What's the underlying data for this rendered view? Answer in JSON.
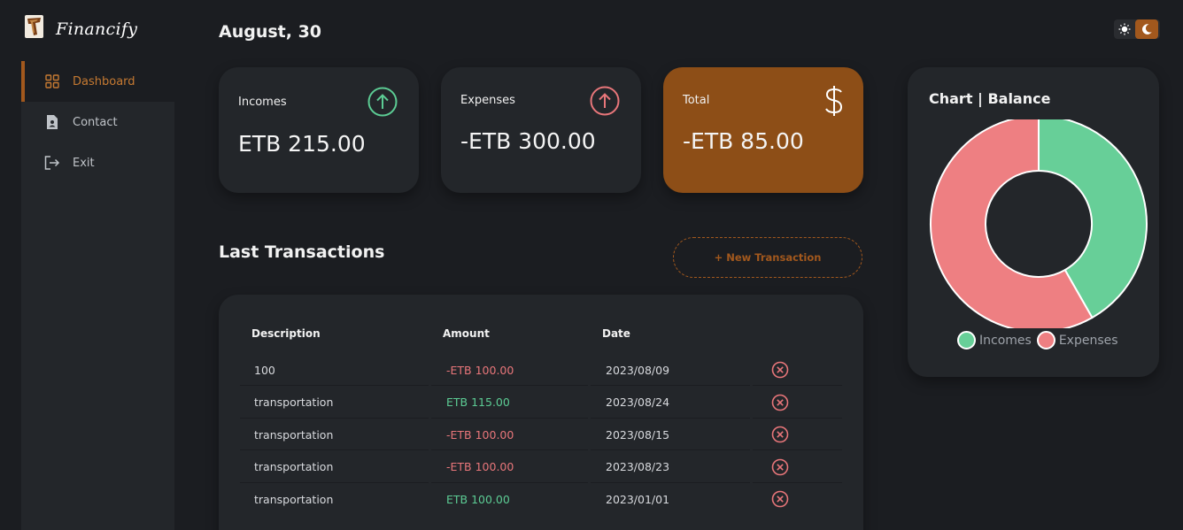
{
  "app": {
    "name": "Financify"
  },
  "sidebar": {
    "items": [
      {
        "label": "Dashboard",
        "icon": "grid-icon",
        "active": true
      },
      {
        "label": "Contact",
        "icon": "contact-card-icon",
        "active": false
      },
      {
        "label": "Exit",
        "icon": "exit-icon",
        "active": false
      }
    ]
  },
  "header": {
    "date": "August, 30"
  },
  "theme": {
    "light_icon": "sun-icon",
    "dark_icon": "moon-icon",
    "active": "dark"
  },
  "cards": {
    "incomes": {
      "label": "Incomes",
      "value": "ETB 215.00",
      "icon": "arrow-up-circle-icon"
    },
    "expenses": {
      "label": "Expenses",
      "value": "-ETB 300.00",
      "icon": "arrow-up-circle-icon"
    },
    "total": {
      "label": "Total",
      "value": "-ETB 85.00",
      "icon": "dollar-icon"
    }
  },
  "transactions": {
    "title": "Last Transactions",
    "new_button": "+ New Transaction",
    "columns": [
      "Description",
      "Amount",
      "Date"
    ],
    "rows": [
      {
        "description": "100",
        "amount": "-ETB 100.00",
        "date": "2023/08/09",
        "type": "expense"
      },
      {
        "description": "transportation",
        "amount": "ETB 115.00",
        "date": "2023/08/24",
        "type": "income"
      },
      {
        "description": "transportation",
        "amount": "-ETB 100.00",
        "date": "2023/08/15",
        "type": "expense"
      },
      {
        "description": "transportation",
        "amount": "-ETB 100.00",
        "date": "2023/08/23",
        "type": "expense"
      },
      {
        "description": "transportation",
        "amount": "ETB 100.00",
        "date": "2023/01/01",
        "type": "income"
      }
    ]
  },
  "chart": {
    "title": "Chart | Balance",
    "legend": [
      "Incomes",
      "Expenses"
    ]
  },
  "chart_data": {
    "type": "pie",
    "title": "Chart | Balance",
    "categories": [
      "Incomes",
      "Expenses"
    ],
    "values": [
      215,
      300
    ],
    "legend_position": "bottom"
  },
  "colors": {
    "accent": "#a2581d",
    "income": "#5ccc94",
    "expense": "#e8767a",
    "card_bg": "#23262a",
    "page_bg": "#1b1d21",
    "chart_income": "#67cf98",
    "chart_expense": "#ee7f82"
  }
}
